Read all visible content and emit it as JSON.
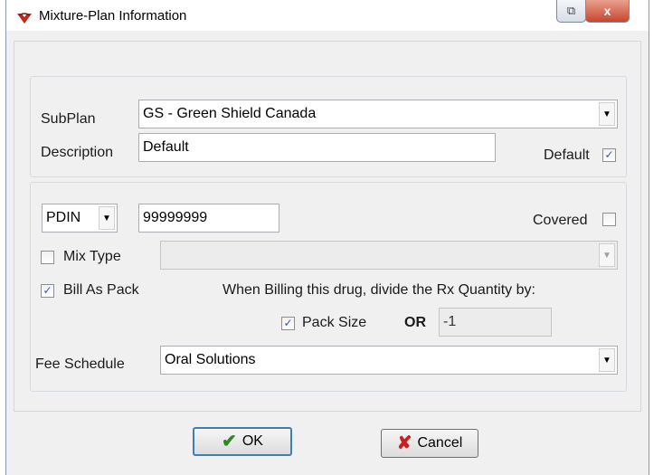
{
  "window": {
    "title": "Mixture-Plan Information",
    "close_glyph": "x"
  },
  "plan": {
    "subplan_label": "SubPlan",
    "subplan_value": "GS - Green Shield Canada",
    "description_label": "Description",
    "description_value": "Default",
    "default_label": "Default",
    "default_checked": true
  },
  "drug": {
    "id_type_value": "PDIN",
    "id_value": "99999999",
    "covered_label": "Covered",
    "covered_checked": false,
    "mix_type_label": "Mix Type",
    "mix_type_checked": false,
    "mix_type_value": "",
    "bill_as_pack_label": "Bill As Pack",
    "bill_as_pack_checked": true,
    "billing_note": "When Billing this drug, divide the Rx Quantity by:",
    "pack_size_label": "Pack Size",
    "pack_size_checked": true,
    "or_label": "OR",
    "quantity_divisor_value": "-1",
    "fee_schedule_label": "Fee Schedule",
    "fee_schedule_value": "Oral Solutions"
  },
  "buttons": {
    "ok_label": "OK",
    "cancel_label": "Cancel"
  },
  "icons": {
    "dropdown": "▼",
    "check": "✓",
    "ok": "✔",
    "cancel": "✘",
    "restore": "⧉"
  }
}
